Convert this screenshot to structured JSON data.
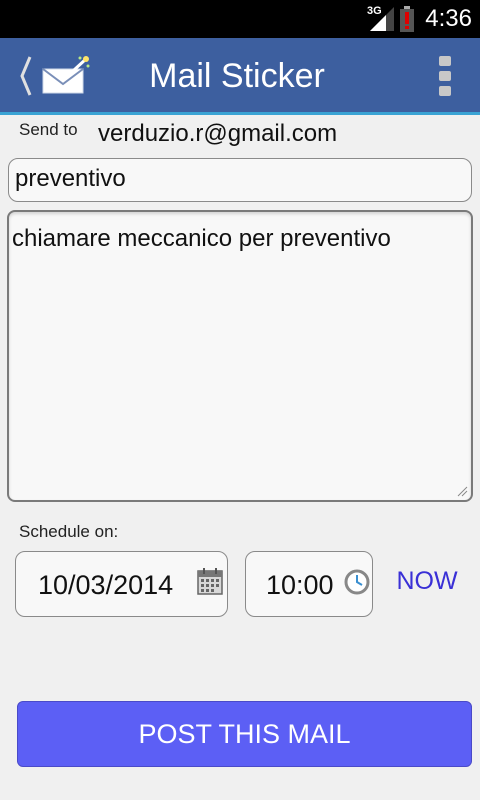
{
  "status_bar": {
    "network": "3G",
    "time": "4:36"
  },
  "action_bar": {
    "title": "Mail Sticker",
    "icons": [
      "back-chevron-icon",
      "mail-wand-icon",
      "overflow-menu-icon"
    ],
    "colors": {
      "background": "#3d5f9f",
      "accent_line": "#3aa3d4"
    }
  },
  "form": {
    "send_to_label": "Send to",
    "send_to_value": "verduzio.r@gmail.com",
    "subject_value": "preventivo",
    "body_value": "chiamare meccanico per preventivo",
    "schedule_label": "Schedule on:",
    "date_value": "10/03/2014",
    "time_value": "10:00",
    "now_label": "NOW",
    "post_label": "POST THIS MAIL"
  },
  "colors": {
    "post_button": "#5c5ff5",
    "now_link": "#3a30d6"
  }
}
